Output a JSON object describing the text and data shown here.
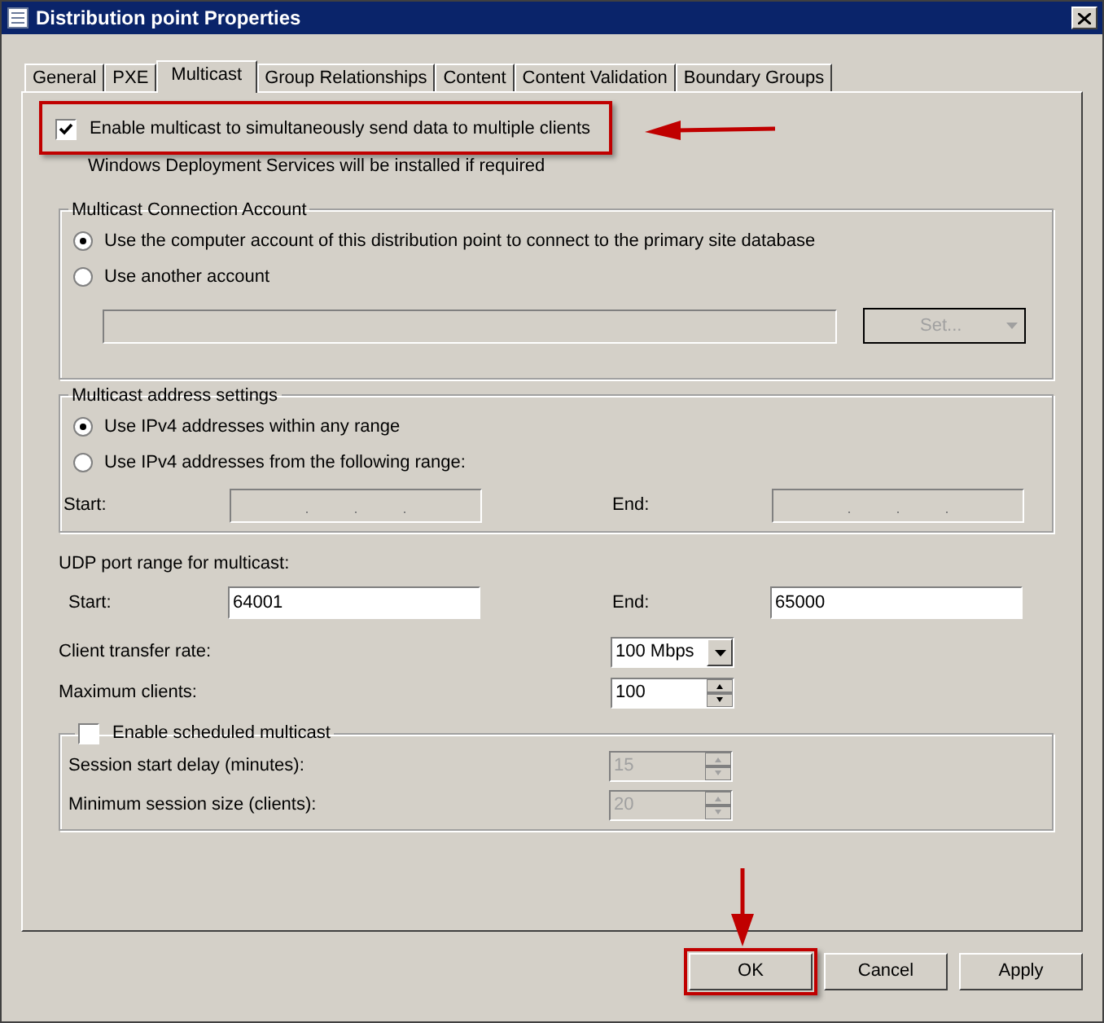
{
  "window": {
    "title": "Distribution point Properties"
  },
  "tabs": [
    {
      "label": "General",
      "selected": false
    },
    {
      "label": "PXE",
      "selected": false
    },
    {
      "label": "Multicast",
      "selected": true
    },
    {
      "label": "Group Relationships",
      "selected": false
    },
    {
      "label": "Content",
      "selected": false
    },
    {
      "label": "Content Validation",
      "selected": false
    },
    {
      "label": "Boundary Groups",
      "selected": false
    }
  ],
  "multicast": {
    "label": "Enable multicast to simultaneously send data to multiple clients",
    "checked": true,
    "highlighted": true,
    "note": "Windows Deployment Services will be installed if required"
  },
  "connection_account": {
    "title": "Multicast Connection Account",
    "options": [
      {
        "label": "Use the computer account of this distribution point to connect to the primary site database",
        "selected": true
      },
      {
        "label": "Use another account",
        "selected": false
      }
    ],
    "set_button": {
      "label": "Set..."
    }
  },
  "address_settings": {
    "title": "Multicast address settings",
    "options": [
      {
        "label": "Use IPv4 addresses within any range",
        "selected": true
      },
      {
        "label": "Use IPv4 addresses from the following range:",
        "selected": false
      }
    ],
    "start": {
      "label": "Start:"
    },
    "end": {
      "label": "End:"
    }
  },
  "udp_ports": {
    "title": "UDP port range for multicast:",
    "start": {
      "label": "Start:",
      "value": "64001"
    },
    "end": {
      "label": "End:",
      "value": "65000"
    }
  },
  "transfer_rate": {
    "label": "Client transfer rate:",
    "value": "100 Mbps"
  },
  "max_clients": {
    "label": "Maximum clients:",
    "value": "100"
  },
  "scheduled": {
    "label": "Enable scheduled multicast",
    "checked": false,
    "fields": [
      {
        "label": "Session start delay (minutes):",
        "value": "15"
      },
      {
        "label": "Minimum session size (clients):",
        "value": "20"
      }
    ]
  },
  "buttons": [
    {
      "label": "OK",
      "highlighted": true
    },
    {
      "label": "Cancel",
      "highlighted": false
    },
    {
      "label": "Apply",
      "highlighted": false
    }
  ]
}
